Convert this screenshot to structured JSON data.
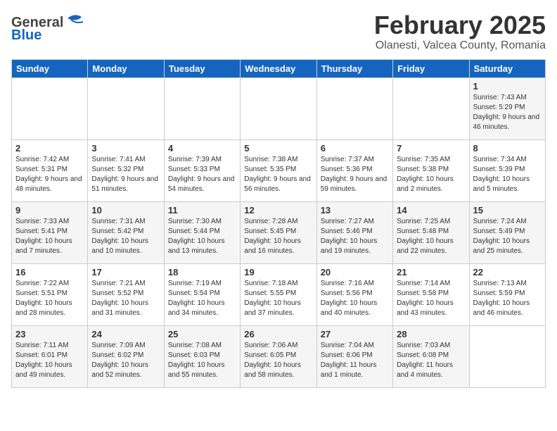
{
  "header": {
    "logo_general": "General",
    "logo_blue": "Blue",
    "month_title": "February 2025",
    "location": "Olanesti, Valcea County, Romania"
  },
  "weekdays": [
    "Sunday",
    "Monday",
    "Tuesday",
    "Wednesday",
    "Thursday",
    "Friday",
    "Saturday"
  ],
  "weeks": [
    [
      {
        "day": "",
        "info": ""
      },
      {
        "day": "",
        "info": ""
      },
      {
        "day": "",
        "info": ""
      },
      {
        "day": "",
        "info": ""
      },
      {
        "day": "",
        "info": ""
      },
      {
        "day": "",
        "info": ""
      },
      {
        "day": "1",
        "info": "Sunrise: 7:43 AM\nSunset: 5:29 PM\nDaylight: 9 hours and 46 minutes."
      }
    ],
    [
      {
        "day": "2",
        "info": "Sunrise: 7:42 AM\nSunset: 5:31 PM\nDaylight: 9 hours and 48 minutes."
      },
      {
        "day": "3",
        "info": "Sunrise: 7:41 AM\nSunset: 5:32 PM\nDaylight: 9 hours and 51 minutes."
      },
      {
        "day": "4",
        "info": "Sunrise: 7:39 AM\nSunset: 5:33 PM\nDaylight: 9 hours and 54 minutes."
      },
      {
        "day": "5",
        "info": "Sunrise: 7:38 AM\nSunset: 5:35 PM\nDaylight: 9 hours and 56 minutes."
      },
      {
        "day": "6",
        "info": "Sunrise: 7:37 AM\nSunset: 5:36 PM\nDaylight: 9 hours and 59 minutes."
      },
      {
        "day": "7",
        "info": "Sunrise: 7:35 AM\nSunset: 5:38 PM\nDaylight: 10 hours and 2 minutes."
      },
      {
        "day": "8",
        "info": "Sunrise: 7:34 AM\nSunset: 5:39 PM\nDaylight: 10 hours and 5 minutes."
      }
    ],
    [
      {
        "day": "9",
        "info": "Sunrise: 7:33 AM\nSunset: 5:41 PM\nDaylight: 10 hours and 7 minutes."
      },
      {
        "day": "10",
        "info": "Sunrise: 7:31 AM\nSunset: 5:42 PM\nDaylight: 10 hours and 10 minutes."
      },
      {
        "day": "11",
        "info": "Sunrise: 7:30 AM\nSunset: 5:44 PM\nDaylight: 10 hours and 13 minutes."
      },
      {
        "day": "12",
        "info": "Sunrise: 7:28 AM\nSunset: 5:45 PM\nDaylight: 10 hours and 16 minutes."
      },
      {
        "day": "13",
        "info": "Sunrise: 7:27 AM\nSunset: 5:46 PM\nDaylight: 10 hours and 19 minutes."
      },
      {
        "day": "14",
        "info": "Sunrise: 7:25 AM\nSunset: 5:48 PM\nDaylight: 10 hours and 22 minutes."
      },
      {
        "day": "15",
        "info": "Sunrise: 7:24 AM\nSunset: 5:49 PM\nDaylight: 10 hours and 25 minutes."
      }
    ],
    [
      {
        "day": "16",
        "info": "Sunrise: 7:22 AM\nSunset: 5:51 PM\nDaylight: 10 hours and 28 minutes."
      },
      {
        "day": "17",
        "info": "Sunrise: 7:21 AM\nSunset: 5:52 PM\nDaylight: 10 hours and 31 minutes."
      },
      {
        "day": "18",
        "info": "Sunrise: 7:19 AM\nSunset: 5:54 PM\nDaylight: 10 hours and 34 minutes."
      },
      {
        "day": "19",
        "info": "Sunrise: 7:18 AM\nSunset: 5:55 PM\nDaylight: 10 hours and 37 minutes."
      },
      {
        "day": "20",
        "info": "Sunrise: 7:16 AM\nSunset: 5:56 PM\nDaylight: 10 hours and 40 minutes."
      },
      {
        "day": "21",
        "info": "Sunrise: 7:14 AM\nSunset: 5:58 PM\nDaylight: 10 hours and 43 minutes."
      },
      {
        "day": "22",
        "info": "Sunrise: 7:13 AM\nSunset: 5:59 PM\nDaylight: 10 hours and 46 minutes."
      }
    ],
    [
      {
        "day": "23",
        "info": "Sunrise: 7:11 AM\nSunset: 6:01 PM\nDaylight: 10 hours and 49 minutes."
      },
      {
        "day": "24",
        "info": "Sunrise: 7:09 AM\nSunset: 6:02 PM\nDaylight: 10 hours and 52 minutes."
      },
      {
        "day": "25",
        "info": "Sunrise: 7:08 AM\nSunset: 6:03 PM\nDaylight: 10 hours and 55 minutes."
      },
      {
        "day": "26",
        "info": "Sunrise: 7:06 AM\nSunset: 6:05 PM\nDaylight: 10 hours and 58 minutes."
      },
      {
        "day": "27",
        "info": "Sunrise: 7:04 AM\nSunset: 6:06 PM\nDaylight: 11 hours and 1 minute."
      },
      {
        "day": "28",
        "info": "Sunrise: 7:03 AM\nSunset: 6:08 PM\nDaylight: 11 hours and 4 minutes."
      },
      {
        "day": "",
        "info": ""
      }
    ]
  ]
}
